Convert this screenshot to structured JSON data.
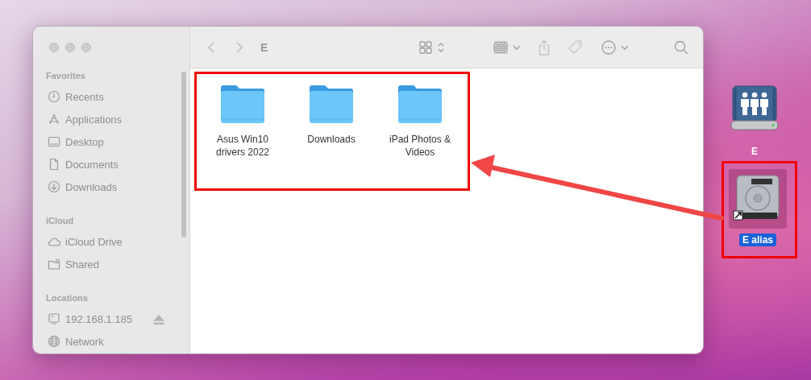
{
  "window": {
    "title": "E",
    "toolbar": {
      "back_enabled": false,
      "forward_enabled": false
    }
  },
  "sidebar": {
    "sections": [
      {
        "heading": "Favorites",
        "items": [
          {
            "label": "Recents",
            "selected": false
          },
          {
            "label": "Applications",
            "selected": false
          },
          {
            "label": "Desktop",
            "selected": false
          },
          {
            "label": "Documents",
            "selected": false
          },
          {
            "label": "Downloads",
            "selected": false
          }
        ]
      },
      {
        "heading": "iCloud",
        "items": [
          {
            "label": "iCloud Drive",
            "selected": false
          },
          {
            "label": "Shared",
            "selected": false
          }
        ]
      },
      {
        "heading": "Locations",
        "items": [
          {
            "label": "192.168.1.185",
            "selected": false,
            "ejectable": true
          },
          {
            "label": "Network",
            "selected": false
          }
        ]
      }
    ]
  },
  "files": [
    {
      "name": "Asus Win10 drivers 2022",
      "selected": false
    },
    {
      "name": "Downloads",
      "selected": false
    },
    {
      "name": "iPad Photos & Videos",
      "selected": false
    }
  ],
  "desktop_icons": [
    {
      "label": "E",
      "kind": "network-drive",
      "selected": false
    },
    {
      "label": "E alias",
      "kind": "drive-alias",
      "selected": true
    }
  ],
  "annotations": [
    {
      "kind": "box"
    },
    {
      "kind": "box"
    },
    {
      "kind": "arrow"
    }
  ]
}
